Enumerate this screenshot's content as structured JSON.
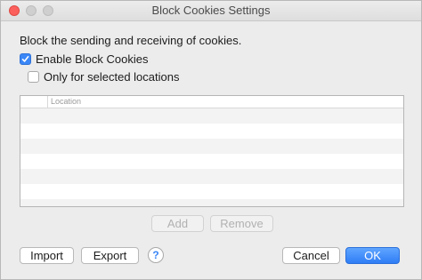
{
  "window": {
    "title": "Block Cookies Settings"
  },
  "description": "Block the sending and receiving of cookies.",
  "options": {
    "enable_block_cookies": {
      "label": "Enable Block Cookies",
      "checked": true
    },
    "only_selected_locations": {
      "label": "Only for selected locations",
      "checked": false
    }
  },
  "table": {
    "columns": [
      "",
      "Location"
    ],
    "rows": []
  },
  "buttons": {
    "add": "Add",
    "remove": "Remove",
    "import": "Import",
    "export": "Export",
    "help": "?",
    "cancel": "Cancel",
    "ok": "OK"
  },
  "colors": {
    "accent": "#3b87f7",
    "close": "#fc605c"
  }
}
